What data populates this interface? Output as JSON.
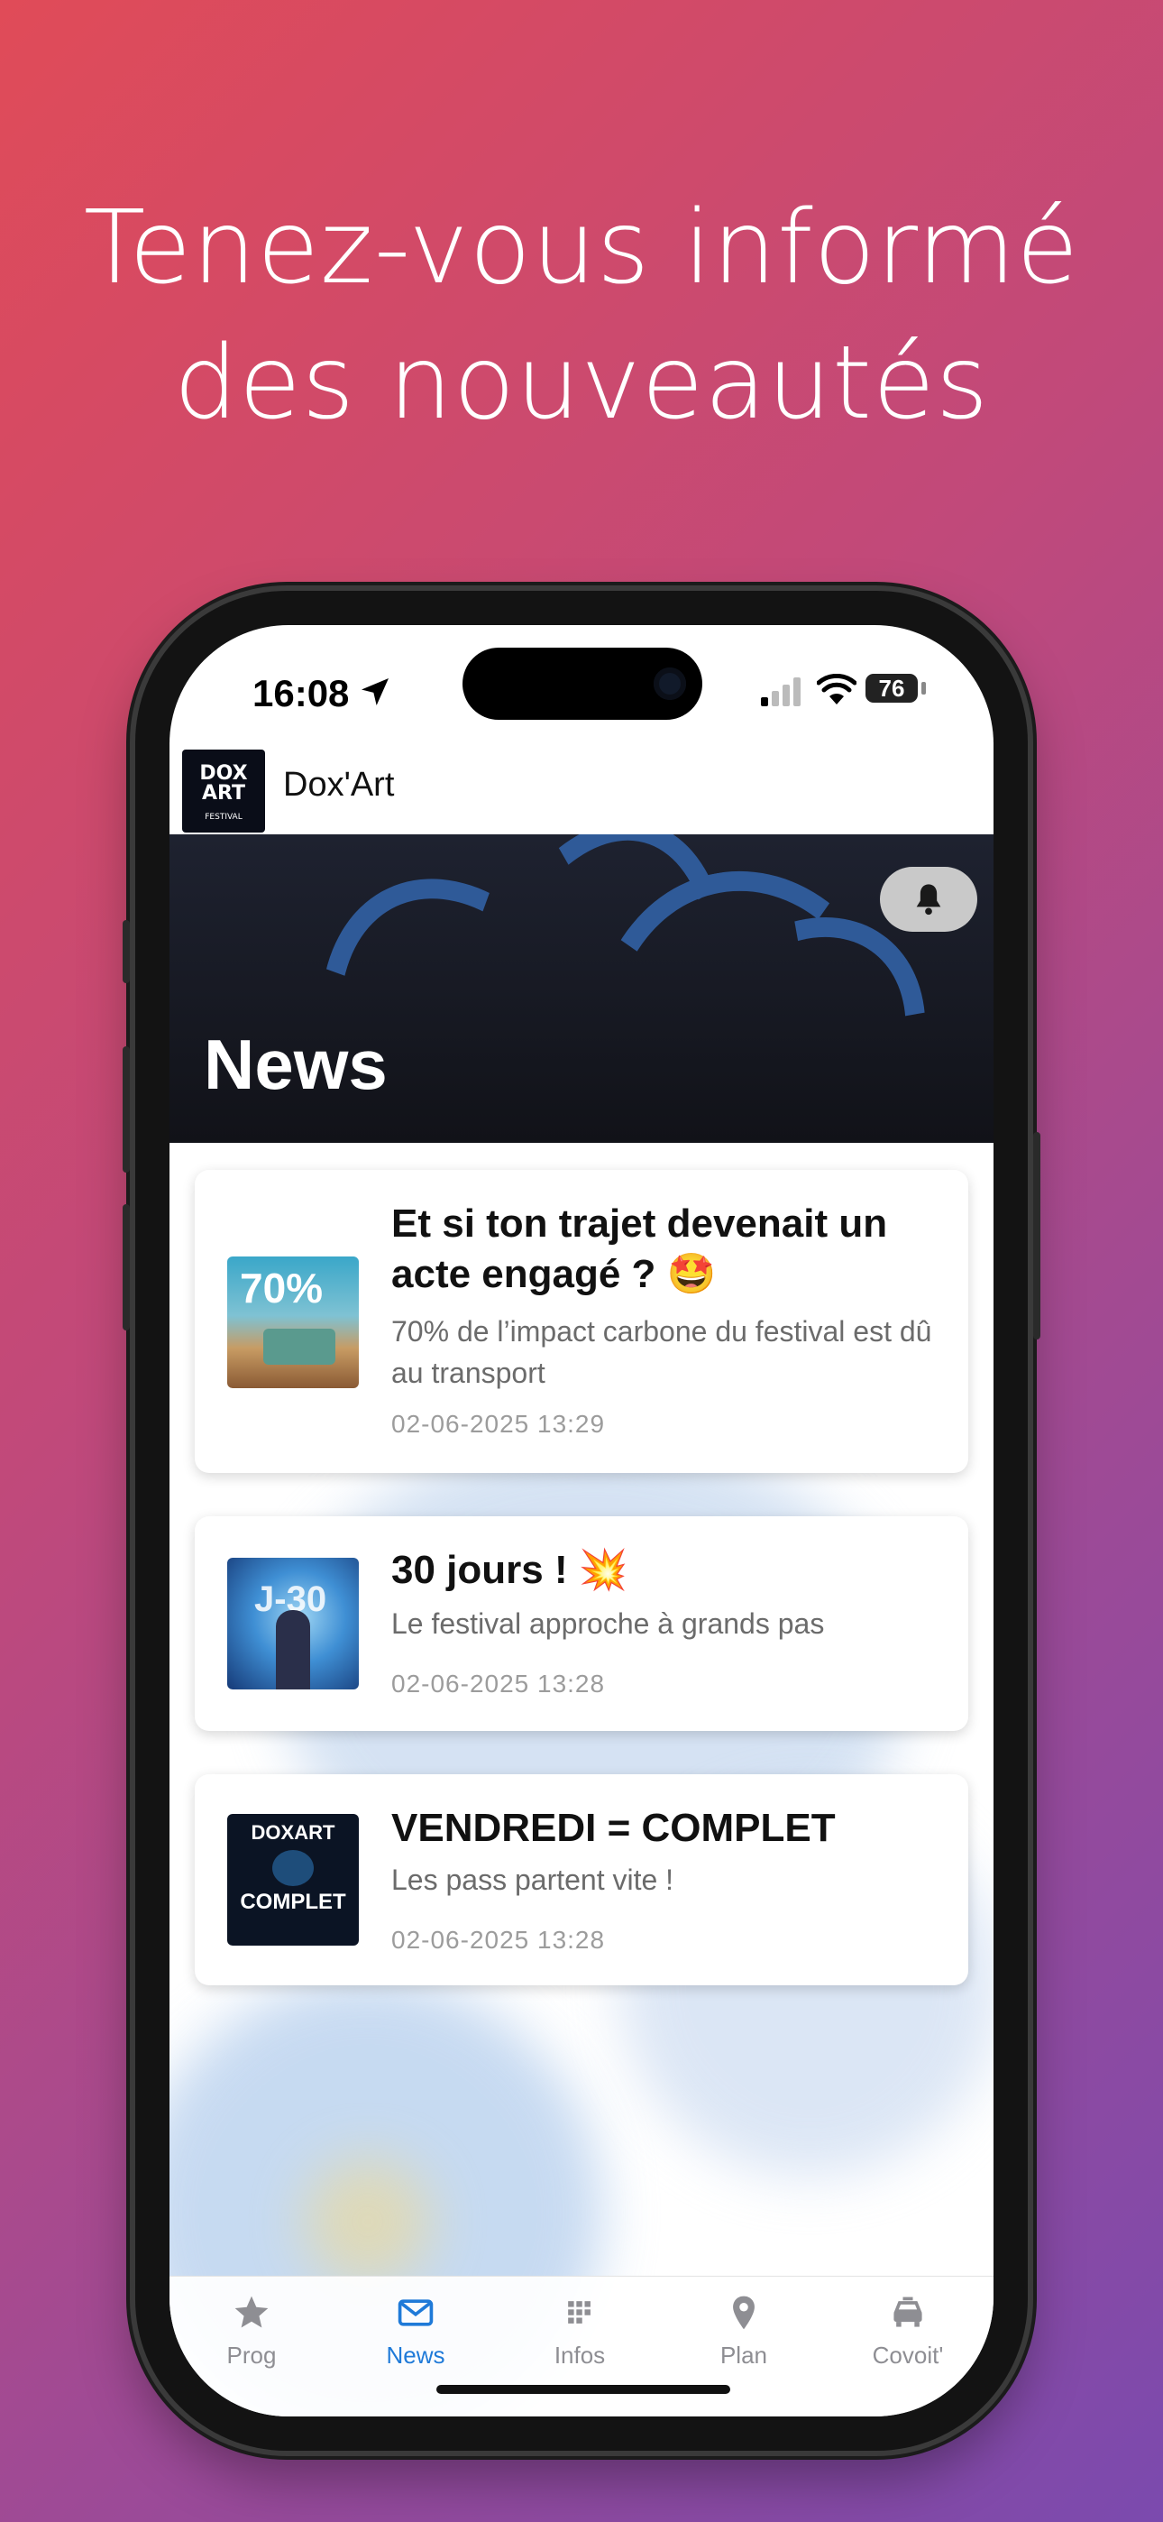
{
  "headline": {
    "line1": "Tenez-vous informé",
    "line2": "des nouveautés"
  },
  "status_bar": {
    "time": "16:08",
    "battery": "76"
  },
  "app": {
    "title": "Dox'Art",
    "logo_text_1": "DOX",
    "logo_text_2": "ART",
    "logo_text_3": "FESTIVAL"
  },
  "hero": {
    "title": "News"
  },
  "news": [
    {
      "title": "Et si ton trajet devenait un acte engagé ? 🤩",
      "subtitle": "70% de l’impact carbone du festival est dû au transport",
      "date": "02-06-2025 13:29",
      "thumb_text": "70%"
    },
    {
      "title": "30 jours ! 💥",
      "subtitle": "Le festival approche à grands pas",
      "date": "02-06-2025 13:28",
      "thumb_text": "J-30"
    },
    {
      "title": "VENDREDI = COMPLET",
      "subtitle": "Les pass partent vite !",
      "date": "02-06-2025 13:28",
      "thumb_text_1": "DOXART",
      "thumb_text_2": "COMPLET"
    }
  ],
  "tabs": [
    {
      "label": "Prog",
      "icon": "star-icon"
    },
    {
      "label": "News",
      "icon": "mail-icon",
      "active": true
    },
    {
      "label": "Infos",
      "icon": "grid-icon"
    },
    {
      "label": "Plan",
      "icon": "pin-icon"
    },
    {
      "label": "Covoit'",
      "icon": "car-icon"
    }
  ],
  "colors": {
    "accent": "#1f7ad8",
    "inactive": "#8e8e93"
  }
}
